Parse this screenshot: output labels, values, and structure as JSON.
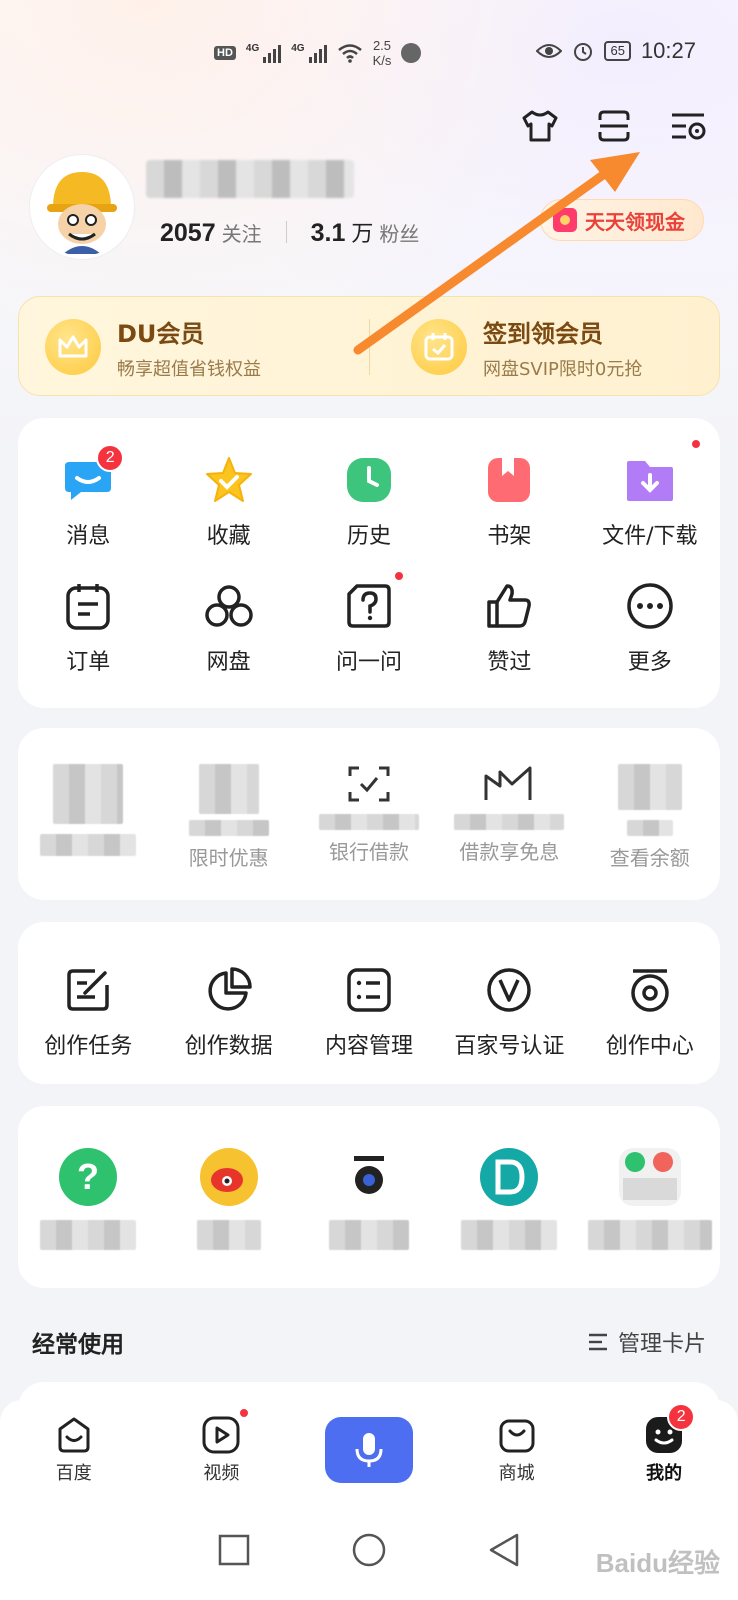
{
  "status_bar": {
    "network_badge": "HD",
    "net1": "4G",
    "net2": "4G",
    "speed_value": "2.5",
    "speed_unit": "K/s",
    "battery": "65",
    "time": "10:27"
  },
  "profile": {
    "following_count": "2057",
    "following_label": "关注",
    "fans_count": "3.1",
    "fans_unit": "万",
    "fans_label": "粉丝",
    "cash_button": "天天领现金"
  },
  "vip": {
    "left_title": "DU会员",
    "left_sub": "畅享超值省钱权益",
    "right_title": "签到领会员",
    "right_sub": "网盘SVIP限时0元抢"
  },
  "tools": [
    {
      "label": "消息",
      "icon": "message-icon",
      "badge": "2"
    },
    {
      "label": "收藏",
      "icon": "star-icon"
    },
    {
      "label": "历史",
      "icon": "clock-icon"
    },
    {
      "label": "书架",
      "icon": "bookmark-icon"
    },
    {
      "label": "文件/下载",
      "icon": "folder-download-icon"
    },
    {
      "label": "订单",
      "icon": "order-icon"
    },
    {
      "label": "网盘",
      "icon": "cloud-disk-icon"
    },
    {
      "label": "问一问",
      "icon": "question-icon"
    },
    {
      "label": "赞过",
      "icon": "thumbs-up-icon"
    },
    {
      "label": "更多",
      "icon": "more-icon"
    }
  ],
  "finance": [
    {
      "label": ""
    },
    {
      "label": "限时优惠"
    },
    {
      "label": "银行借款"
    },
    {
      "label": "借款享免息"
    },
    {
      "label": "查看余额"
    }
  ],
  "creator": [
    {
      "label": "创作任务",
      "icon": "edit-task-icon"
    },
    {
      "label": "创作数据",
      "icon": "pie-chart-icon"
    },
    {
      "label": "内容管理",
      "icon": "list-icon"
    },
    {
      "label": "百家号认证",
      "icon": "verify-v-icon"
    },
    {
      "label": "创作中心",
      "icon": "creator-center-icon"
    }
  ],
  "section": {
    "title": "经常使用",
    "manage": "管理卡片"
  },
  "nav": [
    {
      "label": "百度",
      "icon": "baidu-home-icon"
    },
    {
      "label": "视频",
      "icon": "video-icon"
    },
    {
      "label": "",
      "icon": "mic-icon"
    },
    {
      "label": "商城",
      "icon": "shop-bag-icon"
    },
    {
      "label": "我的",
      "icon": "my-face-icon",
      "badge": "2"
    }
  ],
  "watermark": "Baidu经验",
  "colors": {
    "accent": "#4e6ef2",
    "badge": "#f5333f",
    "vip_title": "#7a4a12",
    "arrow": "#f7892e"
  }
}
